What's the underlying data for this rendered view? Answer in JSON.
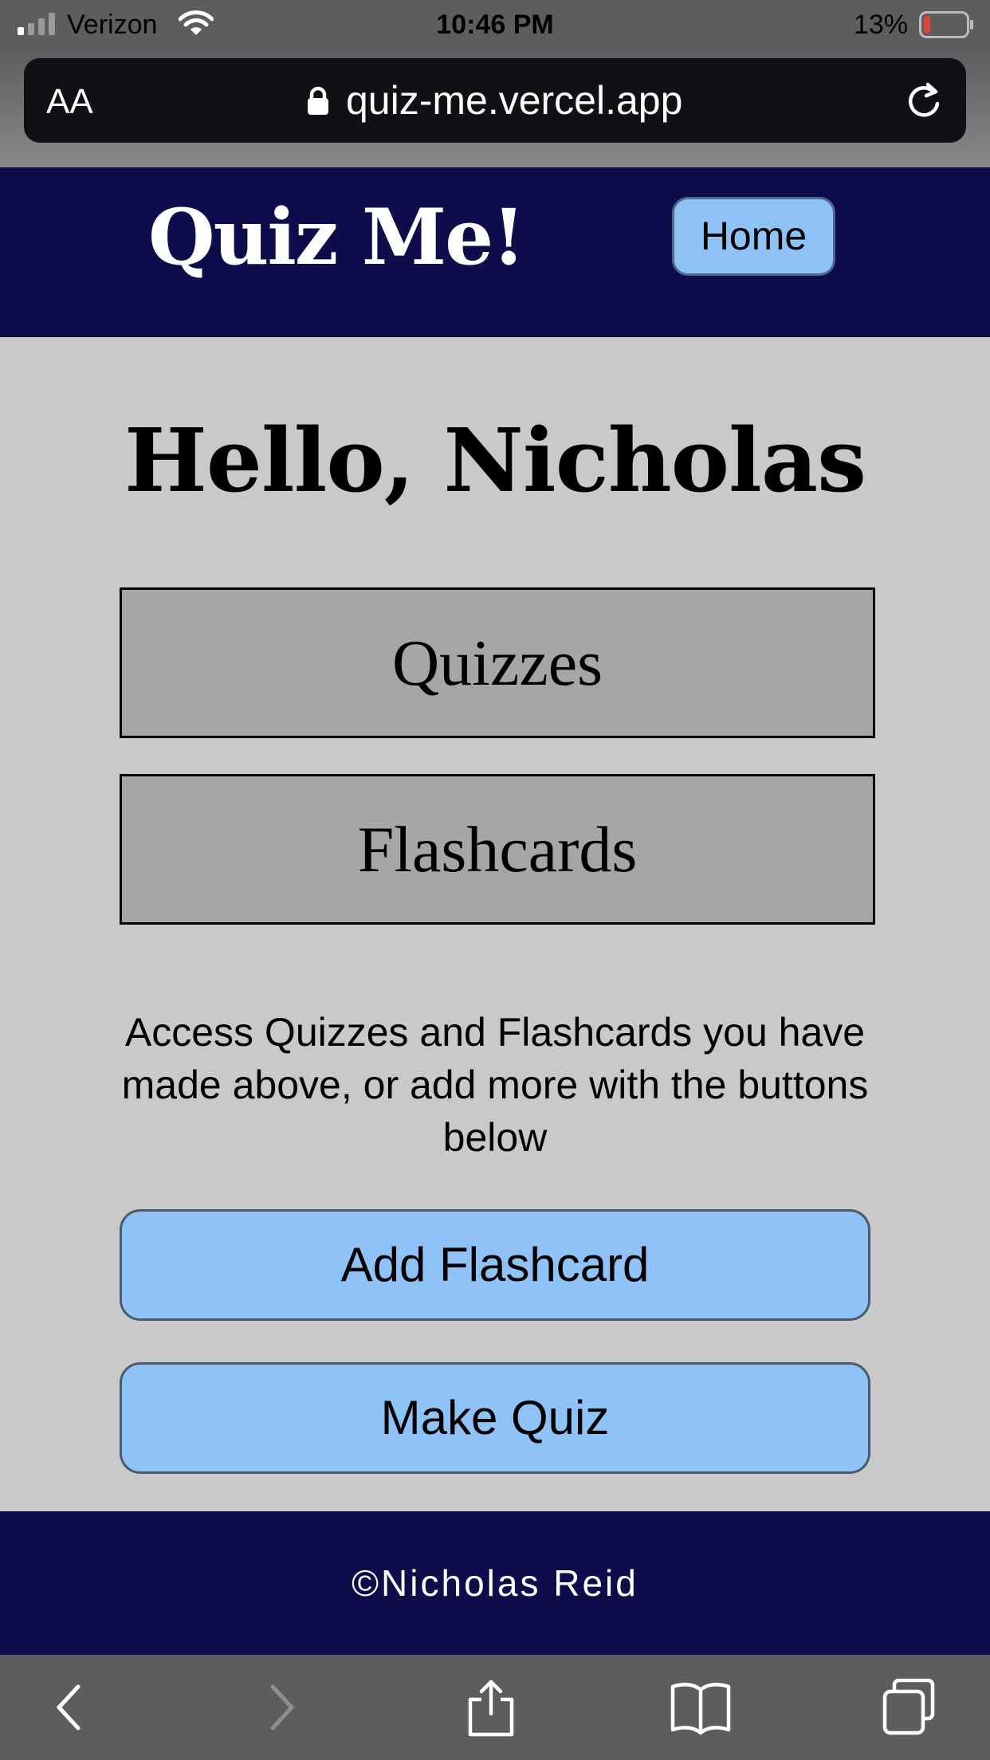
{
  "status_bar": {
    "carrier": "Verizon",
    "time": "10:46 PM",
    "battery_percent": "13%",
    "battery_level": 0.13,
    "icons": [
      "signal-icon",
      "wifi-icon",
      "battery-icon"
    ]
  },
  "browser": {
    "text_size_label": "AA",
    "url": "quiz-me.vercel.app",
    "icons": [
      "lock-icon",
      "reload-icon"
    ]
  },
  "header": {
    "logo": "Quiz Me!",
    "home_label": "Home"
  },
  "main": {
    "greeting": "Hello, Nicholas",
    "nav": {
      "quizzes_label": "Quizzes",
      "flashcards_label": "Flashcards"
    },
    "info_text": "Access Quizzes and Flashcards you have made above, or add more with the buttons below",
    "add_flashcard_label": "Add Flashcard",
    "make_quiz_label": "Make Quiz"
  },
  "footer": {
    "copyright": "©Nicholas Reid"
  },
  "toolbar": {
    "icons": [
      "back-icon",
      "forward-icon",
      "share-icon",
      "bookmarks-icon",
      "tabs-icon"
    ]
  },
  "colors": {
    "header_bg": "#0e0c4a",
    "page_bg": "#c9c9c9",
    "button_blue": "#8fc3f7",
    "nav_box_bg": "#a6a6a6",
    "battery_low": "#e5423a"
  }
}
